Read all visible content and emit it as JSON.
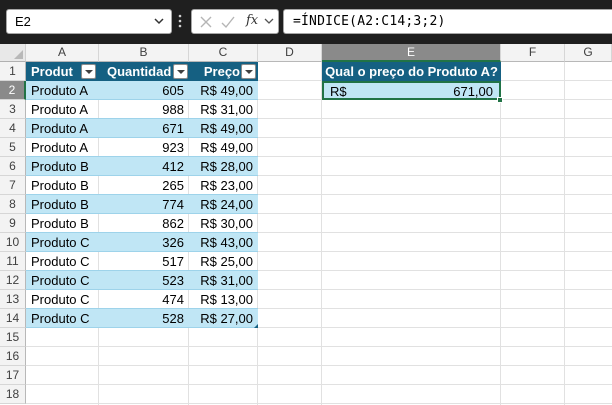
{
  "name_box": {
    "value": "E2"
  },
  "formula_bar": {
    "formula": "=ÍNDICE(A2:C14;3;2)",
    "fx_label": "fx"
  },
  "columns": [
    "A",
    "B",
    "C",
    "D",
    "E",
    "F",
    "G"
  ],
  "rows": [
    "1",
    "2",
    "3",
    "4",
    "5",
    "6",
    "7",
    "8",
    "9",
    "10",
    "11",
    "12",
    "13",
    "14",
    "15",
    "16",
    "17",
    "18"
  ],
  "table": {
    "headers": [
      "Produt",
      "Quantidad",
      "Preço"
    ],
    "rows": [
      [
        "Produto A",
        "605",
        "R$ 49,00"
      ],
      [
        "Produto A",
        "988",
        "R$ 31,00"
      ],
      [
        "Produto A",
        "671",
        "R$ 49,00"
      ],
      [
        "Produto A",
        "923",
        "R$ 49,00"
      ],
      [
        "Produto B",
        "412",
        "R$ 28,00"
      ],
      [
        "Produto B",
        "265",
        "R$ 23,00"
      ],
      [
        "Produto B",
        "774",
        "R$ 24,00"
      ],
      [
        "Produto B",
        "862",
        "R$ 30,00"
      ],
      [
        "Produto C",
        "326",
        "R$ 43,00"
      ],
      [
        "Produto C",
        "517",
        "R$ 25,00"
      ],
      [
        "Produto C",
        "523",
        "R$ 31,00"
      ],
      [
        "Produto C",
        "474",
        "R$ 13,00"
      ],
      [
        "Produto C",
        "528",
        "R$ 27,00"
      ]
    ]
  },
  "question": {
    "header": "Qual o preço do Produto A?",
    "currency": "R$",
    "value": "671,00"
  },
  "selected_cell": {
    "column": "E",
    "row": "2"
  },
  "colors": {
    "table_header": "#156082",
    "band": "#c0e6f5",
    "selection": "#217346",
    "formula_bar_bg": "#1f1f1f"
  }
}
